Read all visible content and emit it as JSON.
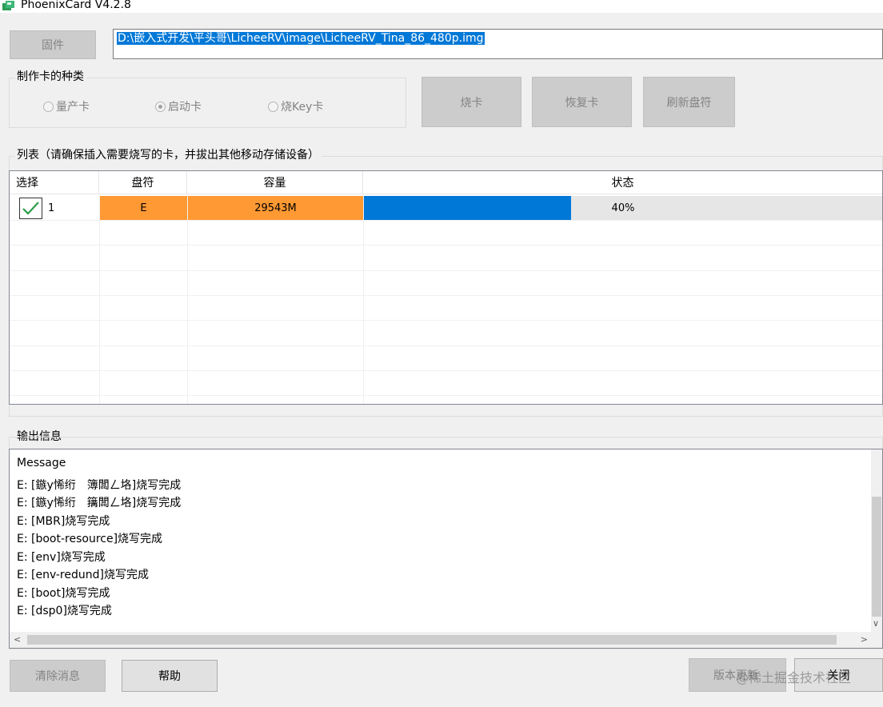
{
  "window": {
    "title": "PhoenixCard V4.2.8"
  },
  "firmware": {
    "button_label": "固件",
    "path": "D:\\嵌入式开发\\平头哥\\LicheeRV\\image\\LicheeRV_Tina_86_480p.img"
  },
  "card_type": {
    "label": "制作卡的种类",
    "options": [
      {
        "label": "量产卡",
        "checked": false
      },
      {
        "label": "启动卡",
        "checked": true
      },
      {
        "label": "烧Key卡",
        "checked": false
      }
    ]
  },
  "actions": {
    "burn": "烧卡",
    "restore": "恢复卡",
    "refresh": "刷新盘符"
  },
  "list": {
    "label": "列表（请确保插入需要烧写的卡，并拔出其他移动存储设备）",
    "columns": [
      "选择",
      "盘符",
      "容量",
      "状态"
    ],
    "rows": [
      {
        "index": "1",
        "selected": true,
        "drive": "E",
        "capacity": "29543M",
        "progress": 0.4,
        "status": "40%"
      }
    ]
  },
  "output": {
    "label": "输出信息",
    "lines": [
      "Message",
      "E: [鏃у悕绗　簿闆ㄥ垎]烧写完成",
      "E: [鏃у悕绗　簼闆ㄥ垎]烧写完成",
      "E: [MBR]烧写完成",
      "E: [boot-resource]烧写完成",
      "E: [env]烧写完成",
      "E: [env-redund]烧写完成",
      "E: [boot]烧写完成",
      "E: [dsp0]烧写完成"
    ]
  },
  "bottom": {
    "clear": "清除消息",
    "help": "帮助",
    "version": "版本更新",
    "close": "关闭"
  },
  "watermark": "@稀土掘金技术社区",
  "colors": {
    "accent": "#0078d7",
    "highlight": "#ff9933"
  }
}
